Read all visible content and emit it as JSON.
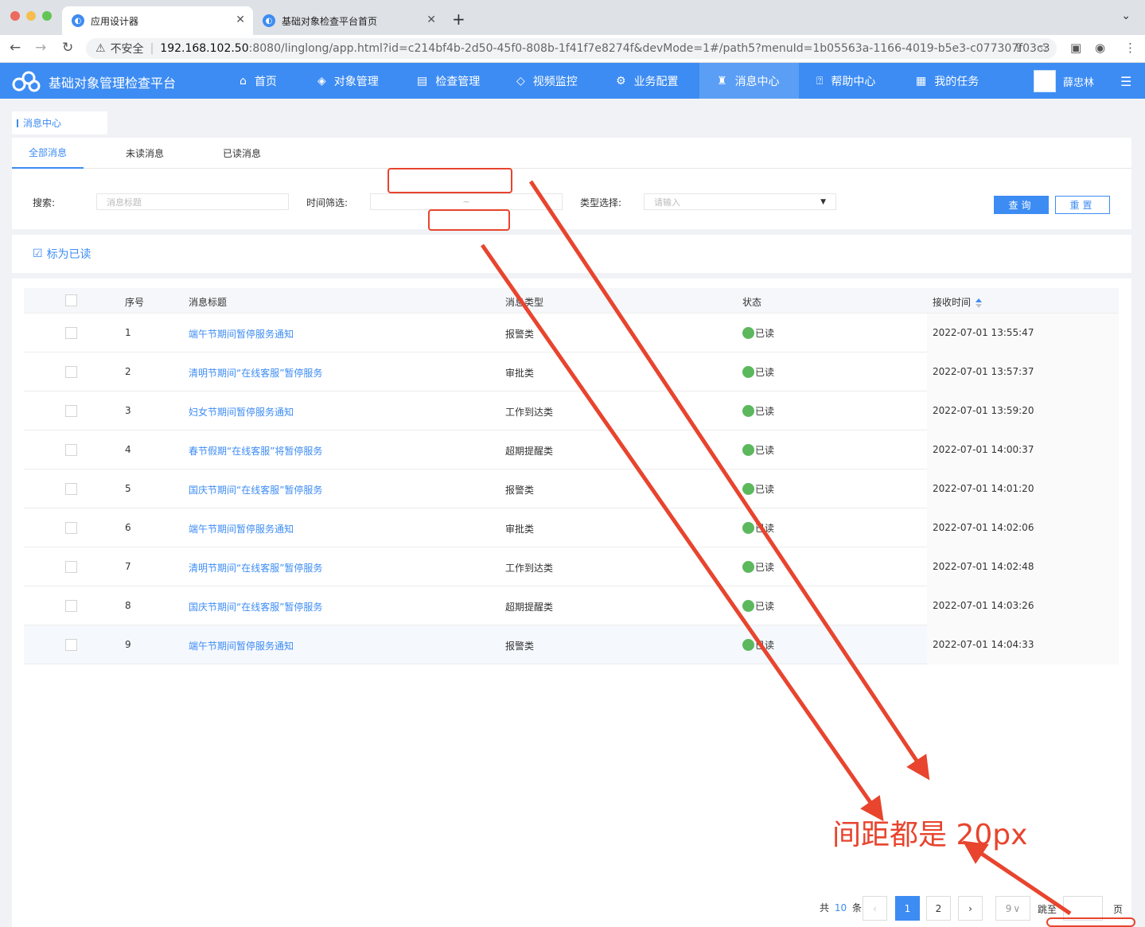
{
  "browser": {
    "tabs": [
      {
        "label": "应用设计器",
        "active": true
      },
      {
        "label": "基础对象检查平台首页",
        "active": false
      }
    ],
    "security": "不安全",
    "url_host": "192.168.102.50",
    "url_path": ":8080/linglong/app.html?id=c214bf4b-2d50-45f0-808b-1f41f7e8274f&devMode=1#/path5?menuId=1b05563a-1166-4019-b5e3-c077307f03c3"
  },
  "app": {
    "title": "基础对象管理检查平台",
    "nav": [
      {
        "label": "首页",
        "icon": "home-icon"
      },
      {
        "label": "对象管理",
        "icon": "cube-icon"
      },
      {
        "label": "检查管理",
        "icon": "doc-check-icon"
      },
      {
        "label": "视频监控",
        "icon": "camera-icon"
      },
      {
        "label": "业务配置",
        "icon": "gear-icon"
      },
      {
        "label": "消息中心",
        "icon": "bell-icon",
        "active": true
      },
      {
        "label": "帮助中心",
        "icon": "help-icon"
      },
      {
        "label": "我的任务",
        "icon": "task-icon"
      }
    ],
    "user": "薛忠林"
  },
  "breadcrumb": "消息中心",
  "tabs": [
    "全部消息",
    "未读消息",
    "已读消息"
  ],
  "filter": {
    "search_label": "搜索:",
    "search_placeholder": "消息标题",
    "time_label": "时间筛选:",
    "time_sep": "~",
    "type_label": "类型选择:",
    "type_placeholder": "请输入",
    "query_btn": "查询",
    "reset_btn": "重置"
  },
  "mark_read": "标为已读",
  "table": {
    "headers": [
      "序号",
      "消息标题",
      "消息类型",
      "状态",
      "接收时间"
    ],
    "rows": [
      {
        "no": "1",
        "title": "端午节期间暂停服务通知",
        "type": "报警类",
        "status": "已读",
        "time": "2022-07-01 13:55:47"
      },
      {
        "no": "2",
        "title": "清明节期间“在线客服”暂停服务",
        "type": "审批类",
        "status": "已读",
        "time": "2022-07-01 13:57:37"
      },
      {
        "no": "3",
        "title": "妇女节期间暂停服务通知",
        "type": "工作到达类",
        "status": "已读",
        "time": "2022-07-01 13:59:20"
      },
      {
        "no": "4",
        "title": "春节假期“在线客服”将暂停服务",
        "type": "超期提醒类",
        "status": "已读",
        "time": "2022-07-01 14:00:37"
      },
      {
        "no": "5",
        "title": "国庆节期间“在线客服”暂停服务",
        "type": "报警类",
        "status": "已读",
        "time": "2022-07-01 14:01:20"
      },
      {
        "no": "6",
        "title": "端午节期间暂停服务通知",
        "type": "审批类",
        "status": "已读",
        "time": "2022-07-01 14:02:06"
      },
      {
        "no": "7",
        "title": "清明节期间“在线客服”暂停服务",
        "type": "工作到达类",
        "status": "已读",
        "time": "2022-07-01 14:02:48"
      },
      {
        "no": "8",
        "title": "国庆节期间“在线客服”暂停服务",
        "type": "超期提醒类",
        "status": "已读",
        "time": "2022-07-01 14:03:26"
      },
      {
        "no": "9",
        "title": "端午节期间暂停服务通知",
        "type": "报警类",
        "status": "已读",
        "time": "2022-07-01 14:04:33"
      }
    ]
  },
  "pager": {
    "total_prefix": "共",
    "total": "10",
    "total_suffix": "条",
    "pages": [
      "1",
      "2"
    ],
    "page_size": "9",
    "jump_label": "跳至",
    "page_suffix": "页"
  },
  "annotation": "间距都是 20px",
  "colors": {
    "accent": "#3d8cf3",
    "annotation": "#e8442e",
    "status_read": "#5cb85c"
  }
}
